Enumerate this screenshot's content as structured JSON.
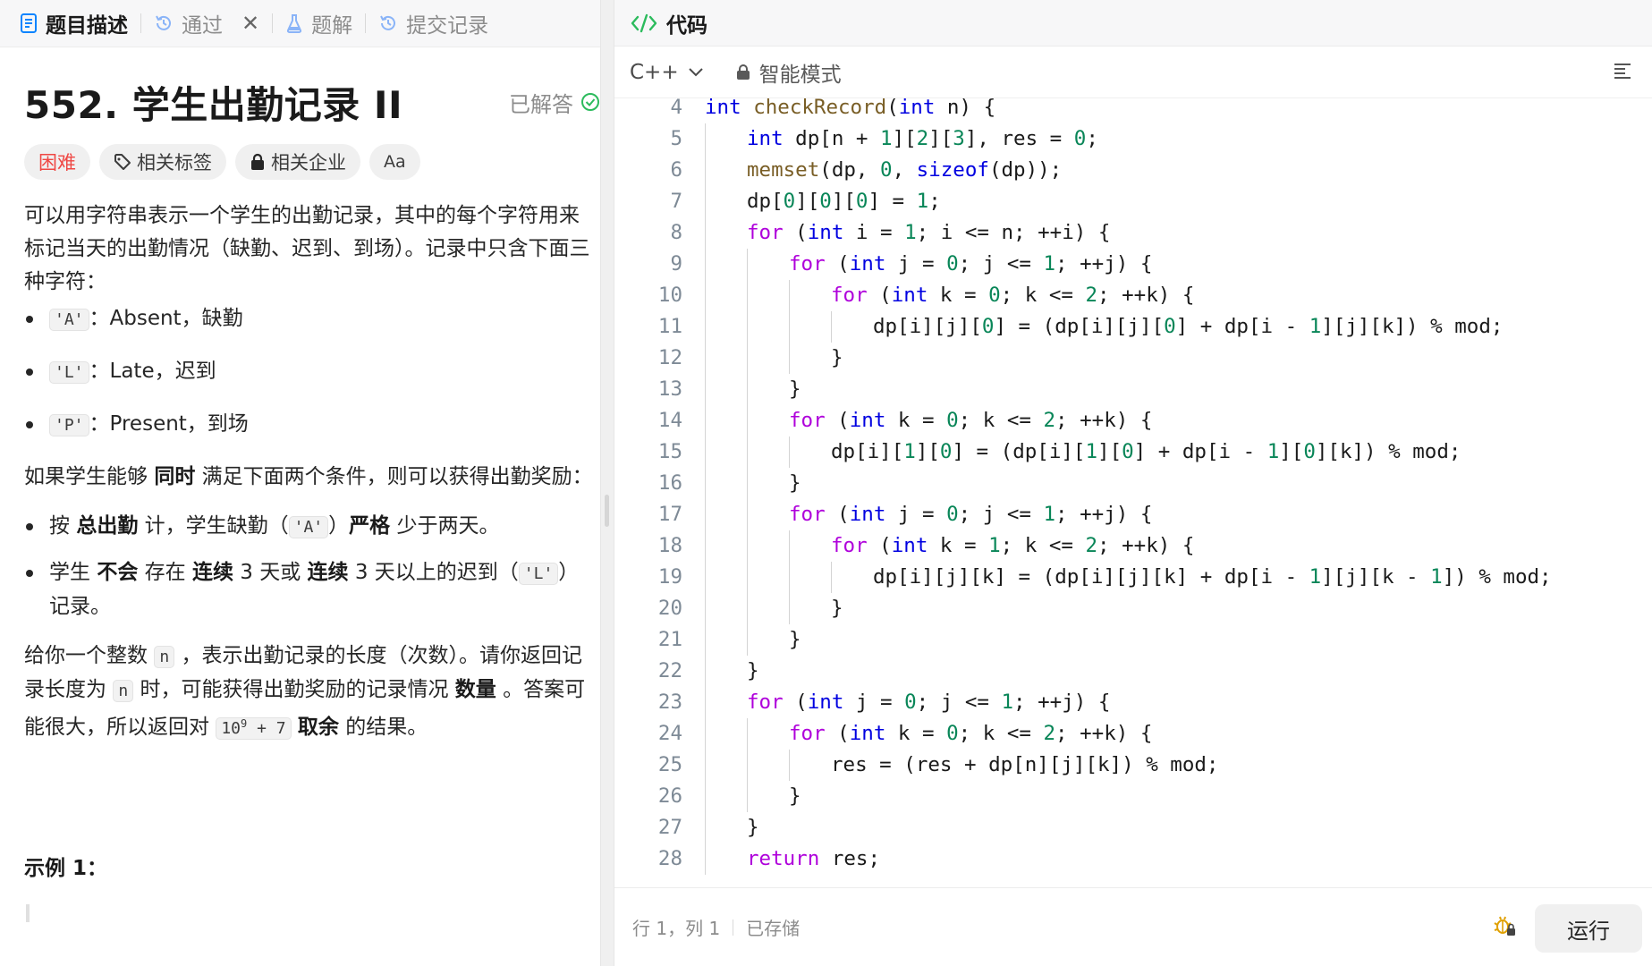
{
  "left_tabs": [
    {
      "label": "题目描述"
    },
    {
      "label": "通过"
    },
    {
      "label": "题解"
    },
    {
      "label": "提交记录"
    }
  ],
  "problem": {
    "title": "552. 学生出勤记录 II",
    "solved_label": "已解答",
    "difficulty": "困难",
    "tag_related": "相关标签",
    "tag_company": "相关企业",
    "font_toggle": "Aa"
  },
  "description": {
    "intro": "可以用字符串表示一个学生的出勤记录，其中的每个字符用来标记当天的出勤情况（缺勤、迟到、到场）。记录中只含下面三种字符：",
    "chars": [
      {
        "code": "'A'",
        "text": "：Absent，缺勤"
      },
      {
        "code": "'L'",
        "text": "：Late，迟到"
      },
      {
        "code": "'P'",
        "text": "：Present，到场"
      }
    ],
    "cond_intro_a": "如果学生能够 ",
    "cond_intro_b": "同时",
    "cond_intro_c": " 满足下面两个条件，则可以获得出勤奖励：",
    "cond1_a": "按 ",
    "cond1_b": "总出勤",
    "cond1_c": " 计，学生缺勤（",
    "cond1_code": "'A'",
    "cond1_d": "）",
    "cond1_e": "严格",
    "cond1_f": " 少于两天。",
    "cond2_a": "学生 ",
    "cond2_b": "不会",
    "cond2_c": " 存在 ",
    "cond2_d": "连续",
    "cond2_e": " 3 天或 ",
    "cond2_f": "连续",
    "cond2_g": " 3 天以上的迟到（",
    "cond2_code": "'L'",
    "cond2_h": "）记录。",
    "task_a": "给你一个整数 ",
    "task_n1": "n",
    "task_b": " ，表示出勤记录的长度（次数）。请你返回记录长度为 ",
    "task_n2": "n",
    "task_c": " 时，可能获得出勤奖励的记录情况 ",
    "task_d": "数量",
    "task_e": " 。答案可能很大，所以返回对 ",
    "task_mod_base": "10",
    "task_mod_exp": "9",
    "task_mod_rest": " + 7",
    "task_f": " ",
    "task_g": "取余",
    "task_h": " 的结果。",
    "example_title": "示例 1："
  },
  "code_panel": {
    "header": "代码",
    "language": "C++",
    "mode": "智能模式"
  },
  "code_lines": [
    {
      "n": "4",
      "indent": 1,
      "tokens": [
        [
          "ty",
          "int"
        ],
        [
          "p",
          " "
        ],
        [
          "fn",
          "checkRecord"
        ],
        [
          "p",
          "("
        ],
        [
          "ty",
          "int"
        ],
        [
          "p",
          " n) {"
        ]
      ]
    },
    {
      "n": "5",
      "indent": 2,
      "tokens": [
        [
          "ty",
          "int"
        ],
        [
          "p",
          " dp[n + "
        ],
        [
          "nm",
          "1"
        ],
        [
          "p",
          "]["
        ],
        [
          "nm",
          "2"
        ],
        [
          "p",
          "]["
        ],
        [
          "nm",
          "3"
        ],
        [
          "p",
          "], res = "
        ],
        [
          "nm",
          "0"
        ],
        [
          "p",
          ";"
        ]
      ]
    },
    {
      "n": "6",
      "indent": 2,
      "tokens": [
        [
          "fn",
          "memset"
        ],
        [
          "p",
          "(dp, "
        ],
        [
          "nm",
          "0"
        ],
        [
          "p",
          ", "
        ],
        [
          "k",
          "sizeof"
        ],
        [
          "p",
          "(dp));"
        ]
      ]
    },
    {
      "n": "7",
      "indent": 2,
      "tokens": [
        [
          "p",
          "dp["
        ],
        [
          "nm",
          "0"
        ],
        [
          "p",
          "]["
        ],
        [
          "nm",
          "0"
        ],
        [
          "p",
          "]["
        ],
        [
          "nm",
          "0"
        ],
        [
          "p",
          "] = "
        ],
        [
          "nm",
          "1"
        ],
        [
          "p",
          ";"
        ]
      ]
    },
    {
      "n": "8",
      "indent": 2,
      "tokens": [
        [
          "kw",
          "for"
        ],
        [
          "p",
          " ("
        ],
        [
          "ty",
          "int"
        ],
        [
          "p",
          " i = "
        ],
        [
          "nm",
          "1"
        ],
        [
          "p",
          "; i <= n; ++i) {"
        ]
      ]
    },
    {
      "n": "9",
      "indent": 3,
      "tokens": [
        [
          "kw",
          "for"
        ],
        [
          "p",
          " ("
        ],
        [
          "ty",
          "int"
        ],
        [
          "p",
          " j = "
        ],
        [
          "nm",
          "0"
        ],
        [
          "p",
          "; j <= "
        ],
        [
          "nm",
          "1"
        ],
        [
          "p",
          "; ++j) {"
        ]
      ]
    },
    {
      "n": "10",
      "indent": 4,
      "tokens": [
        [
          "kw",
          "for"
        ],
        [
          "p",
          " ("
        ],
        [
          "ty",
          "int"
        ],
        [
          "p",
          " k = "
        ],
        [
          "nm",
          "0"
        ],
        [
          "p",
          "; k <= "
        ],
        [
          "nm",
          "2"
        ],
        [
          "p",
          "; ++k) {"
        ]
      ]
    },
    {
      "n": "11",
      "indent": 5,
      "tokens": [
        [
          "p",
          "dp[i][j]["
        ],
        [
          "nm",
          "0"
        ],
        [
          "p",
          "] = (dp[i][j]["
        ],
        [
          "nm",
          "0"
        ],
        [
          "p",
          "] + dp[i - "
        ],
        [
          "nm",
          "1"
        ],
        [
          "p",
          "][j][k]) % mod;"
        ]
      ]
    },
    {
      "n": "12",
      "indent": 4,
      "tokens": [
        [
          "p",
          "}"
        ]
      ]
    },
    {
      "n": "13",
      "indent": 3,
      "tokens": [
        [
          "p",
          "}"
        ]
      ]
    },
    {
      "n": "14",
      "indent": 3,
      "tokens": [
        [
          "kw",
          "for"
        ],
        [
          "p",
          " ("
        ],
        [
          "ty",
          "int"
        ],
        [
          "p",
          " k = "
        ],
        [
          "nm",
          "0"
        ],
        [
          "p",
          "; k <= "
        ],
        [
          "nm",
          "2"
        ],
        [
          "p",
          "; ++k) {"
        ]
      ]
    },
    {
      "n": "15",
      "indent": 4,
      "tokens": [
        [
          "p",
          "dp[i]["
        ],
        [
          "nm",
          "1"
        ],
        [
          "p",
          "]["
        ],
        [
          "nm",
          "0"
        ],
        [
          "p",
          "] = (dp[i]["
        ],
        [
          "nm",
          "1"
        ],
        [
          "p",
          "]["
        ],
        [
          "nm",
          "0"
        ],
        [
          "p",
          "] + dp[i - "
        ],
        [
          "nm",
          "1"
        ],
        [
          "p",
          "]["
        ],
        [
          "nm",
          "0"
        ],
        [
          "p",
          "][k]) % mod;"
        ]
      ]
    },
    {
      "n": "16",
      "indent": 3,
      "tokens": [
        [
          "p",
          "}"
        ]
      ]
    },
    {
      "n": "17",
      "indent": 3,
      "tokens": [
        [
          "kw",
          "for"
        ],
        [
          "p",
          " ("
        ],
        [
          "ty",
          "int"
        ],
        [
          "p",
          " j = "
        ],
        [
          "nm",
          "0"
        ],
        [
          "p",
          "; j <= "
        ],
        [
          "nm",
          "1"
        ],
        [
          "p",
          "; ++j) {"
        ]
      ]
    },
    {
      "n": "18",
      "indent": 4,
      "tokens": [
        [
          "kw",
          "for"
        ],
        [
          "p",
          " ("
        ],
        [
          "ty",
          "int"
        ],
        [
          "p",
          " k = "
        ],
        [
          "nm",
          "1"
        ],
        [
          "p",
          "; k <= "
        ],
        [
          "nm",
          "2"
        ],
        [
          "p",
          "; ++k) {"
        ]
      ]
    },
    {
      "n": "19",
      "indent": 5,
      "tokens": [
        [
          "p",
          "dp[i][j][k] = (dp[i][j][k] + dp[i - "
        ],
        [
          "nm",
          "1"
        ],
        [
          "p",
          "][j][k - "
        ],
        [
          "nm",
          "1"
        ],
        [
          "p",
          "]) % mod;"
        ]
      ]
    },
    {
      "n": "20",
      "indent": 4,
      "tokens": [
        [
          "p",
          "}"
        ]
      ]
    },
    {
      "n": "21",
      "indent": 3,
      "tokens": [
        [
          "p",
          "}"
        ]
      ]
    },
    {
      "n": "22",
      "indent": 2,
      "tokens": [
        [
          "p",
          "}"
        ]
      ]
    },
    {
      "n": "23",
      "indent": 2,
      "tokens": [
        [
          "kw",
          "for"
        ],
        [
          "p",
          " ("
        ],
        [
          "ty",
          "int"
        ],
        [
          "p",
          " j = "
        ],
        [
          "nm",
          "0"
        ],
        [
          "p",
          "; j <= "
        ],
        [
          "nm",
          "1"
        ],
        [
          "p",
          "; ++j) {"
        ]
      ]
    },
    {
      "n": "24",
      "indent": 3,
      "tokens": [
        [
          "kw",
          "for"
        ],
        [
          "p",
          " ("
        ],
        [
          "ty",
          "int"
        ],
        [
          "p",
          " k = "
        ],
        [
          "nm",
          "0"
        ],
        [
          "p",
          "; k <= "
        ],
        [
          "nm",
          "2"
        ],
        [
          "p",
          "; ++k) {"
        ]
      ]
    },
    {
      "n": "25",
      "indent": 4,
      "tokens": [
        [
          "p",
          "res = (res + dp[n][j][k]) % mod;"
        ]
      ]
    },
    {
      "n": "26",
      "indent": 3,
      "tokens": [
        [
          "p",
          "}"
        ]
      ]
    },
    {
      "n": "27",
      "indent": 2,
      "tokens": [
        [
          "p",
          "}"
        ]
      ]
    },
    {
      "n": "28",
      "indent": 2,
      "tokens": [
        [
          "kw",
          "return"
        ],
        [
          "p",
          " res;"
        ]
      ]
    }
  ],
  "statusbar": {
    "position": "行 1，列 1",
    "saved": "已存储",
    "run_label": "运行"
  },
  "colors": {
    "accent_blue": "#0a84ff",
    "hard_red": "#ef4743",
    "solved_green": "#2cbb5d"
  }
}
